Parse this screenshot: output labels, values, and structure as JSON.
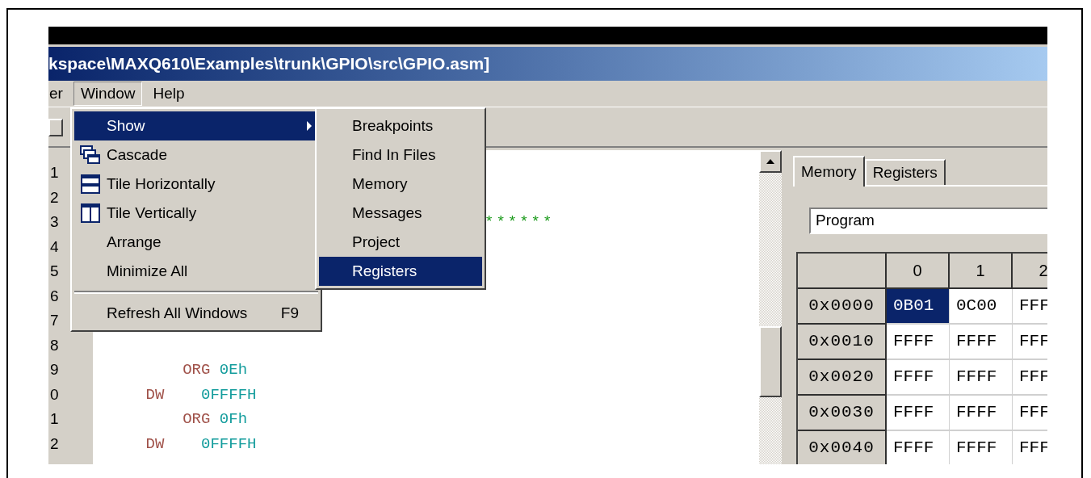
{
  "window": {
    "title": "kspace\\MAXQ610\\Examples\\trunk\\GPIO\\src\\GPIO.asm]"
  },
  "menu_bar": [
    {
      "label": "er",
      "selected": false
    },
    {
      "label": "Window",
      "selected": true
    },
    {
      "label": "Help",
      "selected": false
    }
  ],
  "window_menu": [
    {
      "kind": "submenu",
      "label": "Show",
      "selected": true
    },
    {
      "kind": "item",
      "label": "Cascade",
      "selected": false
    },
    {
      "kind": "item",
      "label": "Tile Horizontally",
      "selected": false
    },
    {
      "kind": "item",
      "label": "Tile Vertically",
      "selected": false
    },
    {
      "kind": "item",
      "label": "Arrange",
      "selected": false
    },
    {
      "kind": "item",
      "label": "Minimize All",
      "selected": false
    },
    {
      "kind": "separator"
    },
    {
      "kind": "item",
      "label": "Refresh All Windows",
      "shortcut": "F9",
      "selected": false
    }
  ],
  "show_submenu": [
    {
      "label": "Breakpoints",
      "selected": false
    },
    {
      "label": "Find In Files",
      "selected": false
    },
    {
      "label": "Memory",
      "selected": false
    },
    {
      "label": "Messages",
      "selected": false
    },
    {
      "label": "Project",
      "selected": false
    },
    {
      "label": "Registers",
      "selected": true
    }
  ],
  "editor": {
    "lines": [
      {
        "number": "1"
      },
      {
        "number": "2"
      },
      {
        "number": "3",
        "tokens": [
          {
            "kind": "comment",
            "text": "******"
          }
        ]
      },
      {
        "number": "4"
      },
      {
        "number": "5"
      },
      {
        "number": "6"
      },
      {
        "number": "7"
      },
      {
        "number": "8"
      },
      {
        "number": "9",
        "tokens": [
          {
            "kind": "keyword",
            "text": "        ORG"
          },
          {
            "kind": "number",
            "text": " 0Eh"
          }
        ]
      },
      {
        "number": "0",
        "tokens": [
          {
            "kind": "keyword",
            "text": "    DW"
          },
          {
            "kind": "number",
            "text": "    0FFFFH"
          }
        ]
      },
      {
        "number": "1",
        "tokens": [
          {
            "kind": "keyword",
            "text": "        ORG"
          },
          {
            "kind": "number",
            "text": " 0Fh"
          }
        ]
      },
      {
        "number": "2",
        "tokens": [
          {
            "kind": "keyword",
            "text": "    DW"
          },
          {
            "kind": "number",
            "text": "    0FFFFH"
          }
        ]
      }
    ]
  },
  "side_panel": {
    "tabs": [
      {
        "label": "Memory",
        "selected": true
      },
      {
        "label": "Registers",
        "selected": false
      }
    ],
    "memory_type": {
      "value": "Program"
    },
    "table": {
      "columns": [
        "",
        "0",
        "1",
        "2"
      ],
      "rows": [
        {
          "cells": [
            {
              "kind": "address",
              "text": "0x0000",
              "selected": false
            },
            {
              "kind": "value",
              "text": "0B01",
              "selected": true
            },
            {
              "kind": "value",
              "text": "0C00",
              "selected": false
            },
            {
              "kind": "value",
              "text": "FFF",
              "selected": false
            }
          ]
        },
        {
          "cells": [
            {
              "kind": "address",
              "text": "0x0010",
              "selected": false
            },
            {
              "kind": "value",
              "text": "FFFF",
              "selected": false
            },
            {
              "kind": "value",
              "text": "FFFF",
              "selected": false
            },
            {
              "kind": "value",
              "text": "FFF",
              "selected": false
            }
          ]
        },
        {
          "cells": [
            {
              "kind": "address",
              "text": "0x0020",
              "selected": false
            },
            {
              "kind": "value",
              "text": "FFFF",
              "selected": false
            },
            {
              "kind": "value",
              "text": "FFFF",
              "selected": false
            },
            {
              "kind": "value",
              "text": "FFF",
              "selected": false
            }
          ]
        },
        {
          "cells": [
            {
              "kind": "address",
              "text": "0x0030",
              "selected": false
            },
            {
              "kind": "value",
              "text": "FFFF",
              "selected": false
            },
            {
              "kind": "value",
              "text": "FFFF",
              "selected": false
            },
            {
              "kind": "value",
              "text": "FFF",
              "selected": false
            }
          ]
        },
        {
          "cells": [
            {
              "kind": "address",
              "text": "0x0040",
              "selected": false
            },
            {
              "kind": "value",
              "text": "FFFF",
              "selected": false
            },
            {
              "kind": "value",
              "text": "FFFF",
              "selected": false
            },
            {
              "kind": "value",
              "text": "FFF",
              "selected": false
            }
          ]
        }
      ]
    }
  }
}
